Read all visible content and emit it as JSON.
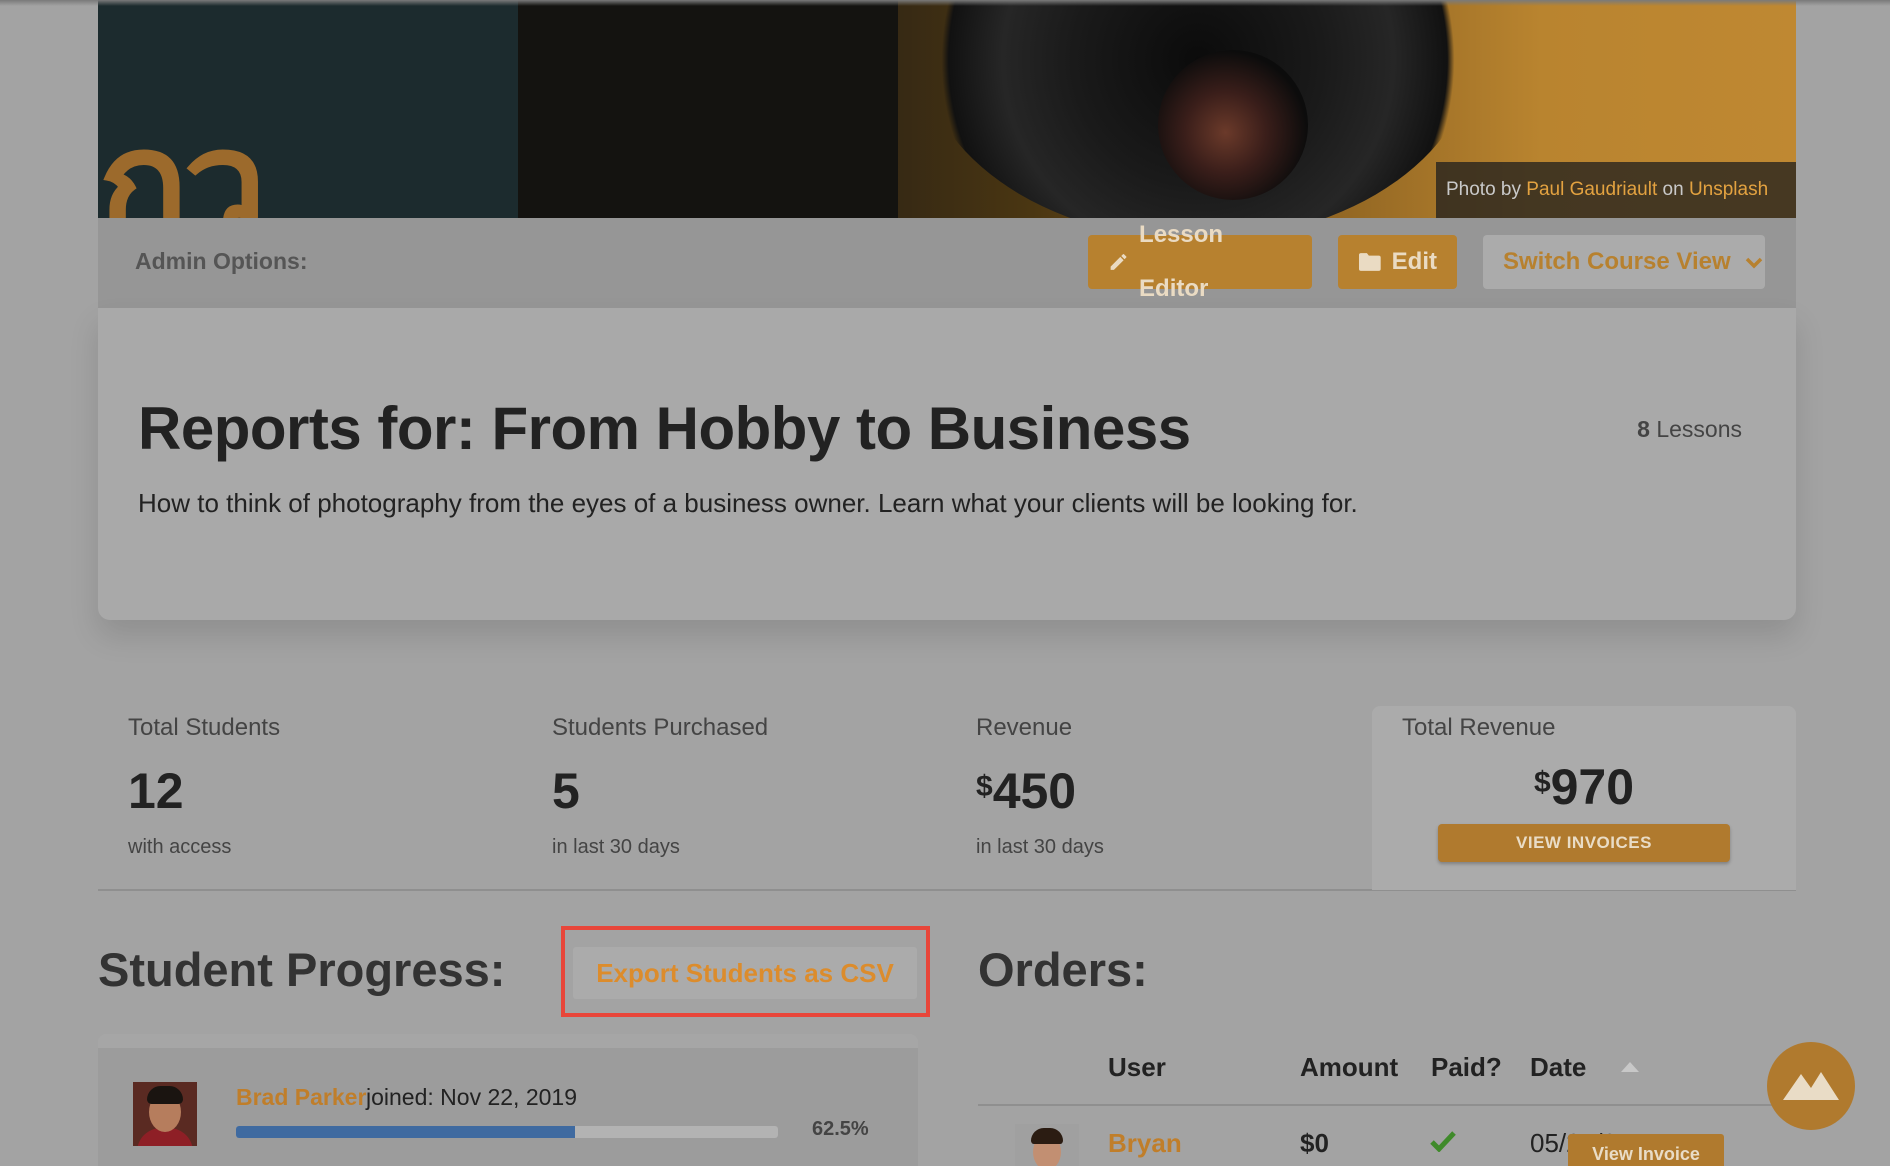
{
  "hero": {
    "credit_prefix": "Photo by",
    "credit_author": "Paul Gaudriault",
    "credit_on": "on",
    "credit_site": "Unsplash"
  },
  "admin": {
    "label": "Admin Options:",
    "lesson_editor": "Lesson Editor",
    "edit": "Edit",
    "switch_view": "Switch Course View"
  },
  "course": {
    "title": "Reports for: From Hobby to Business",
    "description": "How to think of photography from the eyes of a business owner. Learn what your clients will be looking for.",
    "lesson_count": "8",
    "lesson_label": "Lessons"
  },
  "stats": {
    "total_students": {
      "label": "Total Students",
      "value": "12",
      "sub": "with access"
    },
    "students_purchased": {
      "label": "Students Purchased",
      "value": "5",
      "sub": "in last 30 days"
    },
    "revenue": {
      "label": "Revenue",
      "currency": "$",
      "value": "450",
      "sub": "in last 30 days"
    },
    "total_revenue": {
      "label": "Total Revenue",
      "currency": "$",
      "value": "970",
      "button": "VIEW INVOICES"
    }
  },
  "student_progress": {
    "title": "Student Progress:",
    "export_button": "Export Students as CSV",
    "students": [
      {
        "name": "Brad Parker",
        "joined": "joined: Nov 22, 2019",
        "percent": "62.5%",
        "progress": 0.625
      }
    ]
  },
  "orders": {
    "title": "Orders:",
    "columns": {
      "user": "User",
      "amount": "Amount",
      "paid": "Paid?",
      "date": "Date"
    },
    "rows": [
      {
        "user": "Bryan",
        "amount": "$0",
        "paid": true,
        "date": "05/24/21",
        "action": "View Invoice"
      }
    ]
  },
  "colors": {
    "accent": "#b7812f",
    "highlight_outline": "#e8463a",
    "progress_fill": "#3f6aa0",
    "paid_check": "#3f8a2a"
  }
}
